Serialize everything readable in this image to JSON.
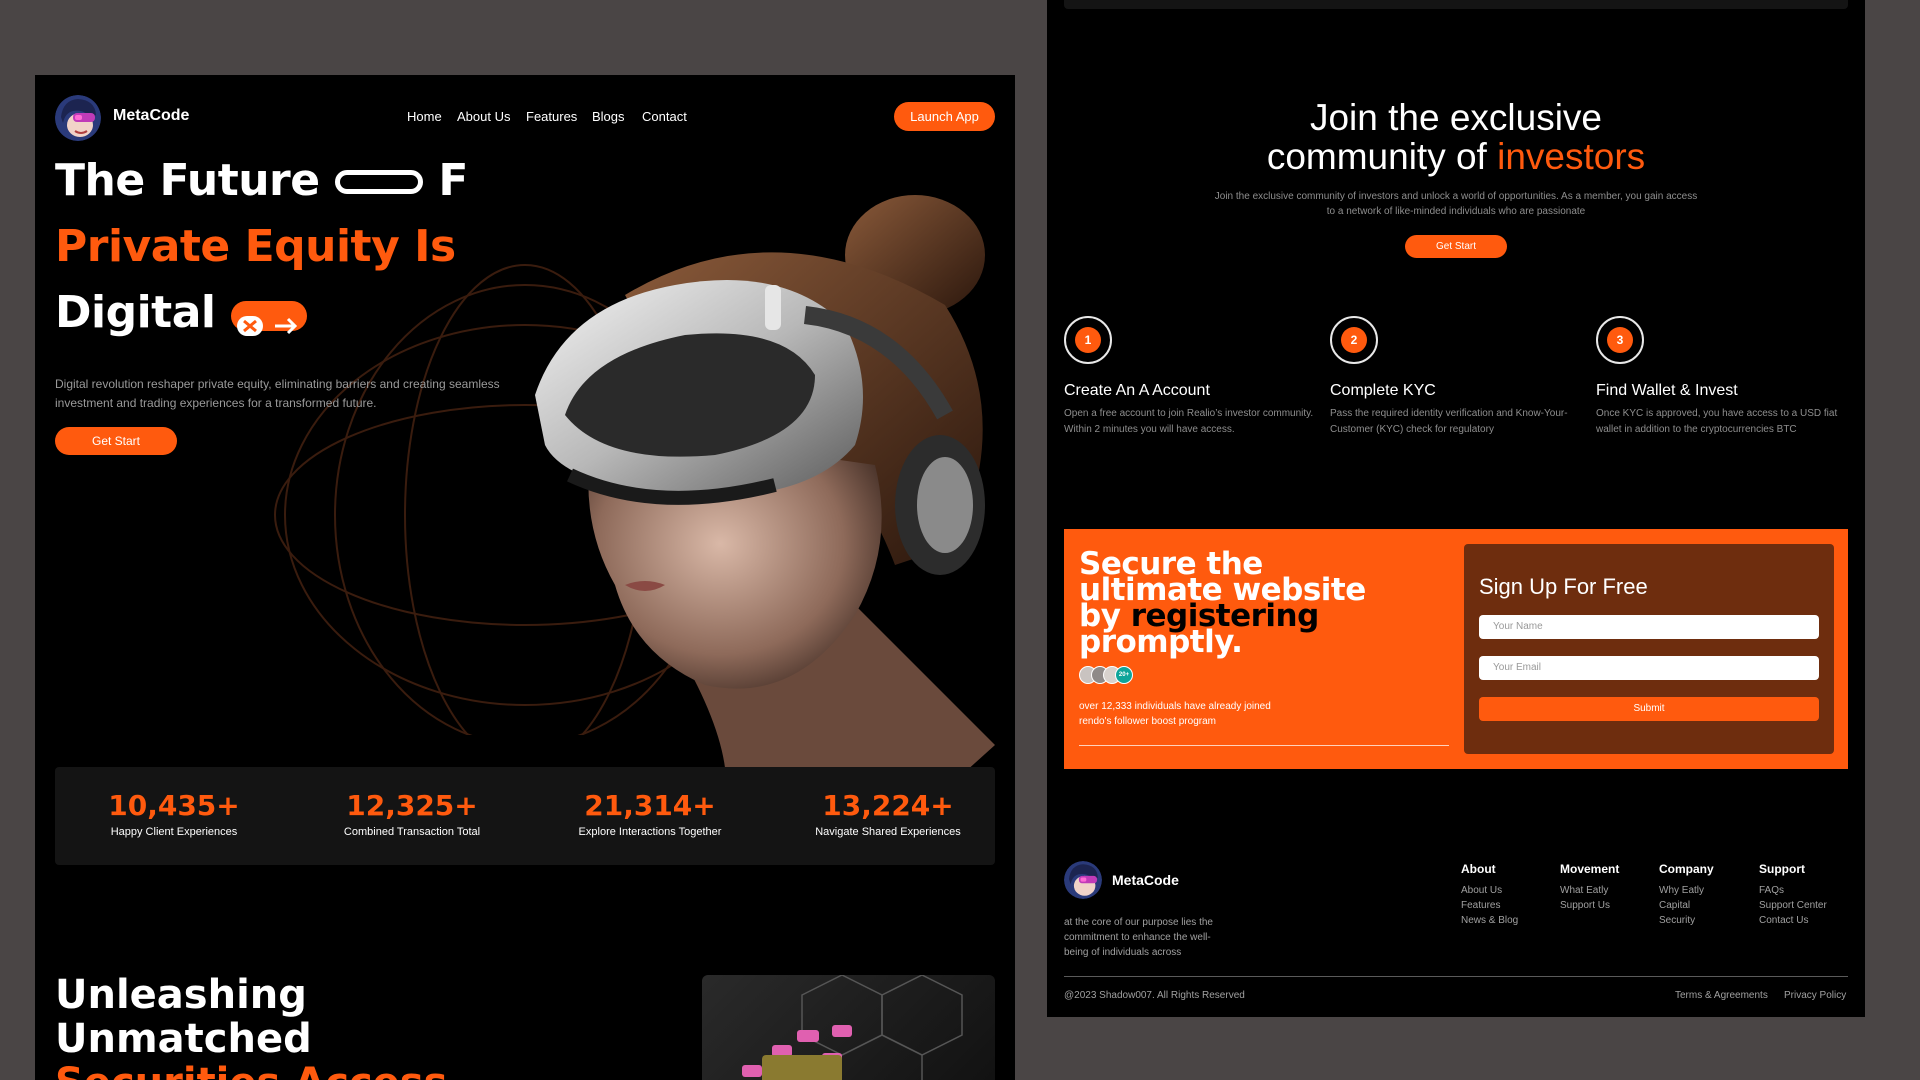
{
  "brand": {
    "name": "MetaCode"
  },
  "nav": {
    "items": [
      "Home",
      "About Us",
      "Features",
      "Blogs",
      "Contact"
    ],
    "cta": "Launch App"
  },
  "hero": {
    "line1": "The Future",
    "line1_tail": "F",
    "line2": "Private Equity Is",
    "line3": "Digital",
    "description": "Digital revolution reshaper private equity, eliminating barriers and creating seamless investment and trading experiences for a transformed future.",
    "cta": "Get Start"
  },
  "stats": [
    {
      "value": "10,435+",
      "label": "Happy Client Experiences"
    },
    {
      "value": "12,325+",
      "label": "Combined Transaction Total"
    },
    {
      "value": "21,314+",
      "label": "Explore Interactions Together"
    },
    {
      "value": "13,224+",
      "label": "Navigate Shared Experiences"
    }
  ],
  "unleash": {
    "line1": "Unleashing",
    "line2": "Unmatched",
    "line3": "Securities Access"
  },
  "community": {
    "title_line1": "Join the exclusive",
    "title_line2_a": "community of ",
    "title_line2_b": "investors",
    "description_line1": "Join the exclusive community of investors and unlock a world of opportunities. As a member, you gain access",
    "description_line2": "to a network of like-minded individuals who are passionate",
    "cta": "Get Start"
  },
  "steps": [
    {
      "number": "1",
      "title": "Create An A Account",
      "description": "Open a free account to join Realio’s investor community. Within 2 minutes you will have access."
    },
    {
      "number": "2",
      "title": "Complete KYC",
      "description": "Pass the required identity verification and Know-Your-Customer (KYC) check for regulatory"
    },
    {
      "number": "3",
      "title": "Find Wallet & Invest",
      "description": "Once KYC is approved, you have access to a USD fiat wallet in addition to the cryptocurrencies BTC"
    }
  ],
  "signup_banner": {
    "headline_line1": "Secure the",
    "headline_line2": "ultimate website",
    "headline_line3_a": "by ",
    "headline_line3_b": "registering",
    "headline_line4": "promptly.",
    "avatar_badge": "20+",
    "note_line1": "over 12,333 individuals have already joined",
    "note_line2": "rendo's follower boost program",
    "form": {
      "title": "Sign Up For Free",
      "name_placeholder": "Your Name",
      "email_placeholder": "Your Email",
      "submit": "Submit"
    }
  },
  "footer": {
    "tagline_line1": "at the core of our purpose lies the",
    "tagline_line2": "commitment to enhance the well-",
    "tagline_line3": "being of individuals across",
    "columns": [
      {
        "heading": "About",
        "links": [
          "About Us",
          "Features",
          "News & Blog"
        ]
      },
      {
        "heading": "Movement",
        "links": [
          "What Eatly",
          "Support Us"
        ]
      },
      {
        "heading": "Company",
        "links": [
          "Why Eatly",
          "Capital",
          "Security"
        ]
      },
      {
        "heading": "Support",
        "links": [
          "FAQs",
          "Support Center",
          "Contact Us"
        ]
      }
    ],
    "copyright": "@2023 Shadow007. All Rights Reserved",
    "terms": "Terms & Agreements",
    "privacy": "Privacy Policy"
  },
  "colors": {
    "accent": "#ff5a0e",
    "background": "#000000",
    "canvas": "#4a4545",
    "form_panel": "#6e2d0e"
  },
  "icons": [
    "logo-avatar-icon",
    "toggle-arrow-icon",
    "arrow-right-icon"
  ]
}
